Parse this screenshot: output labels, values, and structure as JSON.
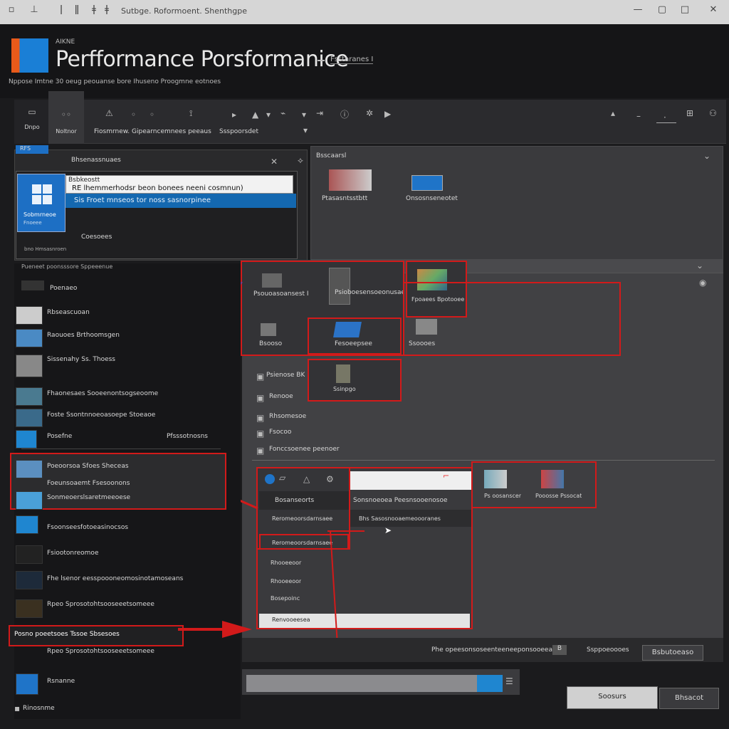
{
  "titlebar": {
    "title": "Sutbge. Roformoent. Shenthgpe",
    "icons": [
      "app-icon",
      "back-icon",
      "pin-icon",
      "menu-icon",
      "more-icon"
    ],
    "controls": [
      "—",
      "▢",
      "□",
      "✕"
    ]
  },
  "header": {
    "small_brand": "AIKNE",
    "title": "Perfformance  Porsformanice",
    "badge": "Fsstaranes I",
    "subtitle": "Nppose Imtne  30 oeug peouanse  bore Ihuseno Proogmne eotnoes"
  },
  "toolbar": {
    "group1": [
      "Dnpo",
      "Noltnor"
    ],
    "main_label": "Fiosmrnew. Gipearncemnees peeaus",
    "secondary_label": "Ssspoorsdet"
  },
  "left_panel": {
    "header": "Bhsenassnuaes",
    "tab_label": "RFS",
    "dialog_title": "Bsbkeostt",
    "selected_text": "RE lhemmerhodsr beon bonees  neeni cosmnun)",
    "highlight_text": "Sis  Froet mnseos  tor  noss sasnorpinee",
    "icon_caption": "Sobmrneoe",
    "icon_caption2": "Fnoeee",
    "footer": "Coesoees",
    "footer2": "bno Hmsasnroen"
  },
  "right_panel": {
    "header": "Bsscaarsl",
    "items": [
      {
        "label": "Ptasasntsstbtt"
      },
      {
        "label": "Onsosnseneotet"
      }
    ]
  },
  "sidebar": {
    "top_label": "Pueneet poonsssore Sppeeenue",
    "section": "Poenaeo",
    "items": [
      {
        "label": "Rbseascuoan"
      },
      {
        "label": "Raouoes Brthoomsgen"
      },
      {
        "label": "Sissenahy Ss. Thoess"
      },
      {
        "label": "Fhaonesaes  Sooeenontsogseoome"
      },
      {
        "label": "Foste  Ssontnnoeoasoepe Stoeaoe"
      },
      {
        "label": "Posefne",
        "right": "Pfsssotnosns"
      },
      {
        "label": "Poeoorsoa Sfoes  Sheceas"
      },
      {
        "label": "Foeunsoaemt Fsesoonons"
      },
      {
        "label": "Sonmeoerslsaretmeeoese"
      },
      {
        "label": "Fsoonseesfotoeasinocsos"
      },
      {
        "label": "Fsiootonreomoe"
      },
      {
        "label": "Fhe lsenor eesspoooneomosinotamoseans"
      },
      {
        "label": "Rpeo  Sprosotohtsooseeetsomeee"
      },
      {
        "label": "Posno poeetsoes Tssoe  Sbsesoes"
      },
      {
        "label": "Rsnanne"
      },
      {
        "label": "Rinosnme"
      }
    ]
  },
  "main": {
    "bar_label": "",
    "cards": [
      {
        "label": "Psouoasoansest I"
      },
      {
        "label": "Psioboesensoeonusae"
      },
      {
        "label": "Fpoaees  Bpotooee"
      },
      {
        "label": "Bsooso"
      },
      {
        "label": "Ssinpgo"
      },
      {
        "label": "Fesoeepsee"
      },
      {
        "label": "Ssoooes"
      }
    ],
    "list_title": "Psienose  BK",
    "list": [
      "Renooe",
      "Rhsomesoe",
      "Fsocoo",
      "Fonccsoenee  peenoer"
    ],
    "footer_status": "Phe  opeesonsoseenteeneeponsooeeaeos",
    "footer_count": "B",
    "footer_right": "Ssppoeoooes",
    "footer_button": "Bsbutoeaso"
  },
  "popup": {
    "items": [
      "Bosanseorts",
      "Reromeoorsdarnsaee",
      "Rhooeeoor",
      "Bosepoinc",
      "Renvooeesea"
    ],
    "menu_title": "Sonsnoeoea Peesnsooenosoe",
    "menu_item": "Bhs  Sasosnooaemeoooranes",
    "side_items": [
      {
        "label": "Ps  oosanscer"
      },
      {
        "label": "Pooosse  Pssocat"
      }
    ]
  },
  "bottom": {
    "progress": 0.92,
    "ok_label": "Soosurs",
    "cancel_label": "Bhsacot"
  },
  "colors": {
    "accent": "#1f86d0",
    "highlight": "#d21a1a"
  }
}
